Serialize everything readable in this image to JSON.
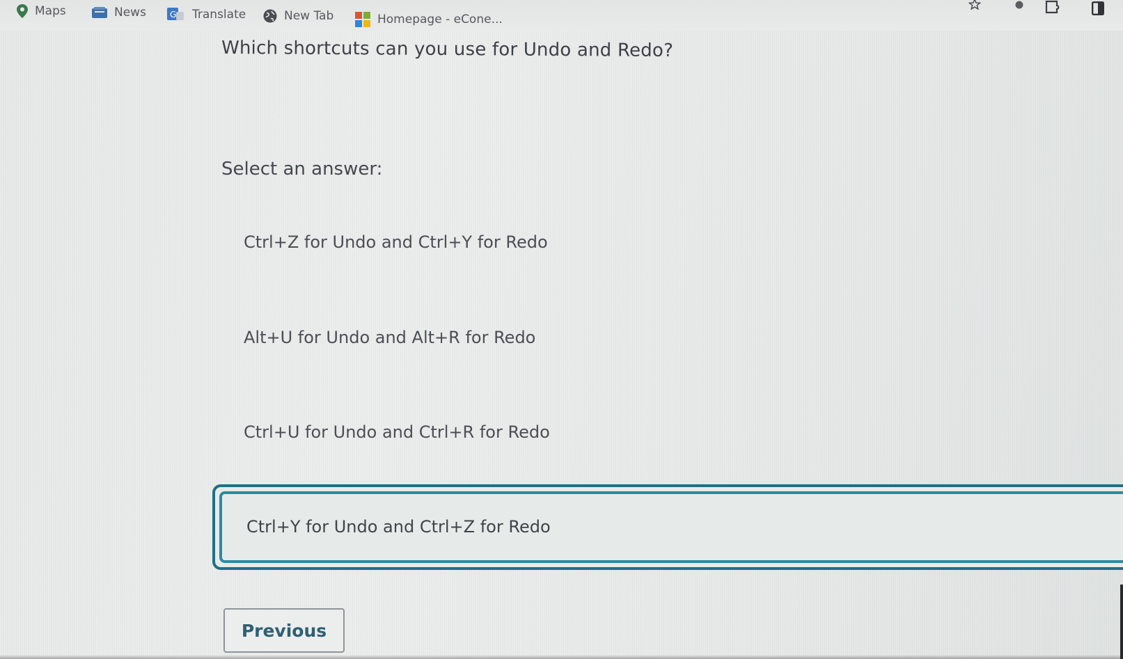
{
  "bookmarks": [
    {
      "label": "Maps",
      "icon": "map-pin-icon"
    },
    {
      "label": "News",
      "icon": "news-icon"
    },
    {
      "label": "Translate",
      "icon": "translate-icon"
    },
    {
      "label": "New Tab",
      "icon": "globe-icon"
    },
    {
      "label": "Homepage - eCone...",
      "icon": "windows-logo-icon"
    }
  ],
  "toolbar_icons": [
    "bookmark-star-icon",
    "profile-dot-icon",
    "extension-icon",
    "side-panel-icon"
  ],
  "quiz": {
    "question": "Which shortcuts can you use for Undo and Redo?",
    "select_label": "Select an answer:",
    "options": [
      "Ctrl+Z for Undo and Ctrl+Y for Redo",
      "Alt+U for Undo and Alt+R for Redo",
      "Ctrl+U for Undo and Ctrl+R for Redo",
      "Ctrl+Y for Undo and Ctrl+Z for Redo"
    ],
    "selected_index": 3,
    "previous_label": "Previous"
  },
  "colors": {
    "accent": "#2c8aa3",
    "accent_dark": "#1f6f86",
    "button_text": "#2f5f73",
    "background": "#e9ebea"
  }
}
